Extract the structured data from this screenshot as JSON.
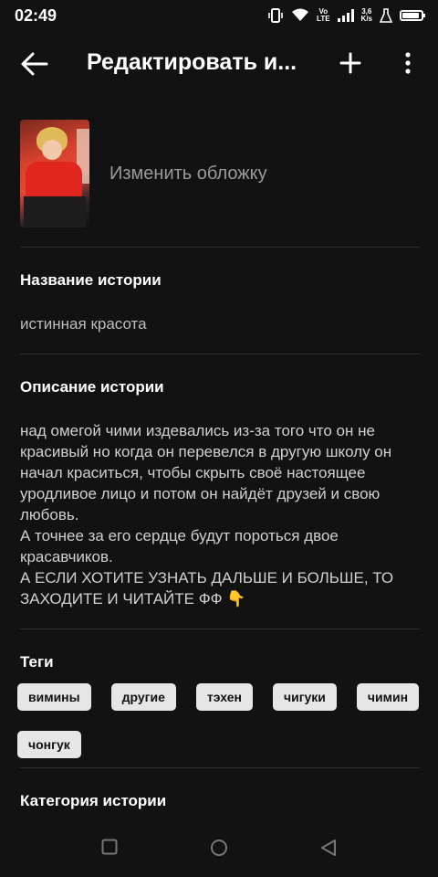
{
  "status_bar": {
    "time": "02:49",
    "network_top": "Vo",
    "network_bottom": "LTE",
    "speed_top": "3,6",
    "speed_bottom": "K/s",
    "battery_level": 0.9
  },
  "app_bar": {
    "title": "Редактировать и...",
    "icons": [
      "back-arrow-icon",
      "plus-icon",
      "more-vertical-icon"
    ]
  },
  "cover": {
    "label": "Изменить обложку"
  },
  "story_title": {
    "label": "Название истории",
    "value": "истинная красота"
  },
  "story_description": {
    "label": "Описание истории",
    "value": "над омегой чими издевались из-за того что он не красивый но когда он перевелся в другую школу он начал краситься, чтобы скрыть своё настоящее уродливое лицо и потом он найдёт друзей и свою любовь.\nА точнее за его сердце будут пороться двое красавчиков.\nА ЕСЛИ ХОТИТЕ УЗНАТЬ ДАЛЬШЕ И БОЛЬШЕ, ТО ЗАХОДИТЕ И ЧИТАЙТЕ ФФ 👇"
  },
  "tags": {
    "label": "Теги",
    "items": [
      "вимины",
      "другие",
      "тэхен",
      "чигуки",
      "чимин",
      "чонгук"
    ]
  },
  "category": {
    "label": "Категория истории"
  },
  "nav_bar": {
    "icons": [
      "recent-apps-icon",
      "home-icon",
      "back-triangle-icon"
    ]
  }
}
